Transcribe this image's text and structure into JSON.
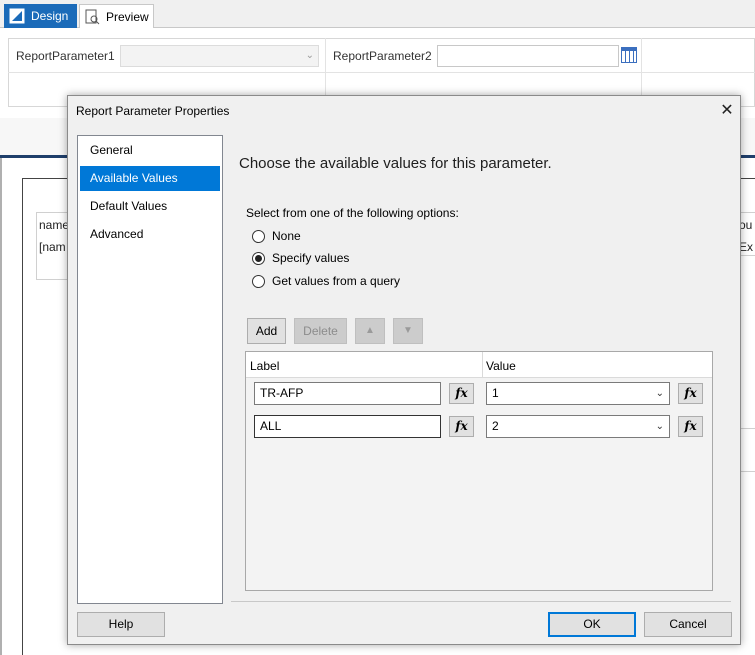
{
  "tabs": {
    "design": "Design",
    "preview": "Preview"
  },
  "params": {
    "p1_label": "ReportParameter1",
    "p2_label": "ReportParameter2"
  },
  "background": {
    "cell1": "name",
    "cell2": "[nam",
    "cell3": "ou",
    "cell4": "Ex"
  },
  "dialog": {
    "title": "Report Parameter Properties",
    "nav": [
      "General",
      "Available Values",
      "Default Values",
      "Advanced"
    ],
    "selected_nav": "Available Values",
    "heading": "Choose the available values for this parameter.",
    "options_label": "Select from one of the following options:",
    "options": [
      "None",
      "Specify values",
      "Get values from a query"
    ],
    "selected_option": "Specify values",
    "buttons": {
      "add": "Add",
      "delete": "Delete"
    },
    "grid": {
      "col_label": "Label",
      "col_value": "Value",
      "rows": [
        {
          "label": "TR-AFP",
          "value": "1"
        },
        {
          "label": "ALL",
          "value": "2"
        }
      ]
    },
    "fx": "fx",
    "footer": {
      "help": "Help",
      "ok": "OK",
      "cancel": "Cancel"
    }
  }
}
